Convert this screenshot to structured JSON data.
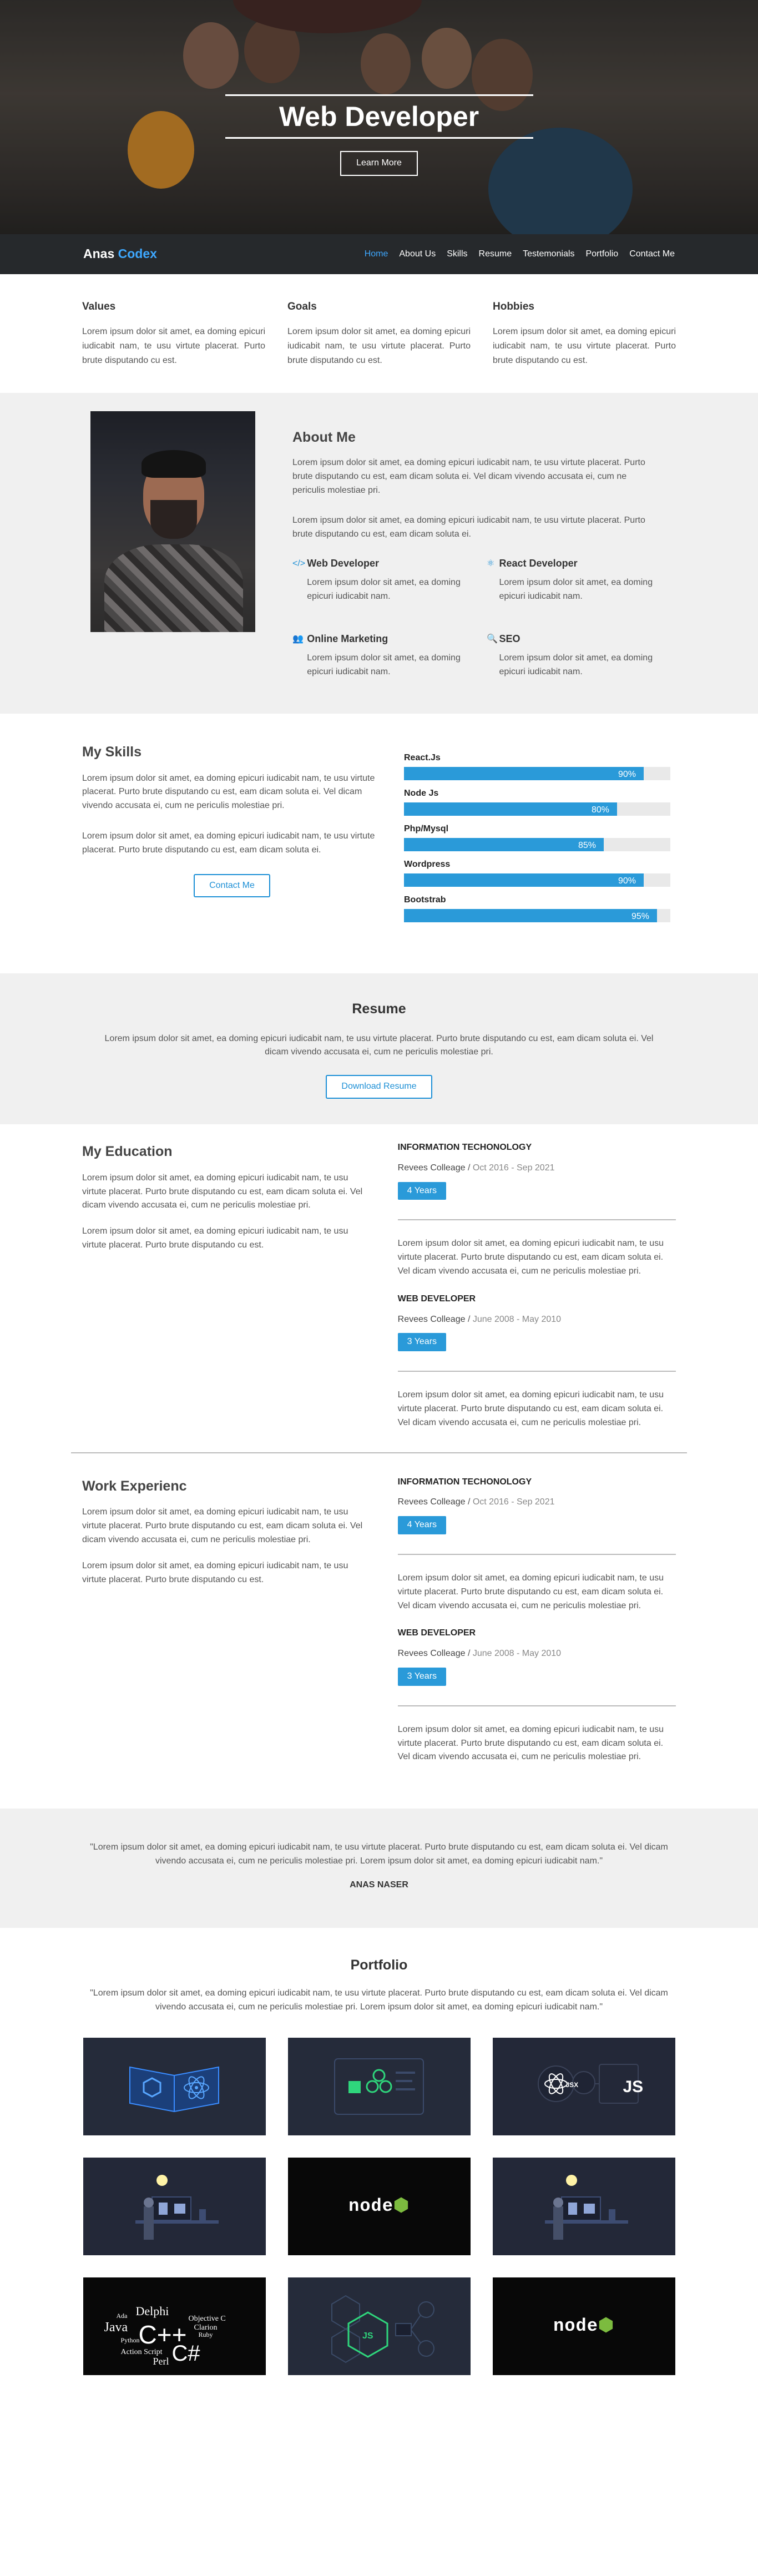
{
  "hero": {
    "title": "Web Developer",
    "button": "Learn More"
  },
  "nav": {
    "brand_first": "Anas",
    "brand_second": "Codex",
    "items": [
      "Home",
      "About Us",
      "Skills",
      "Resume",
      "Testemonials",
      "Portfolio",
      "Contact Me"
    ],
    "accent": "#3ea8ff"
  },
  "values": [
    {
      "title": "Values",
      "text": "Lorem ipsum dolor sit amet, ea doming epicuri iudicabit nam, te usu virtute placerat. Purto brute disputando cu est."
    },
    {
      "title": "Goals",
      "text": "Lorem ipsum dolor sit amet, ea doming epicuri iudicabit nam, te usu virtute placerat. Purto brute disputando cu est."
    },
    {
      "title": "Hobbies",
      "text": "Lorem ipsum dolor sit amet, ea doming epicuri iudicabit nam, te usu virtute placerat. Purto brute disputando cu est."
    }
  ],
  "about": {
    "title": "About Me",
    "p1": "Lorem ipsum dolor sit amet, ea doming epicuri iudicabit nam, te usu virtute placerat. Purto brute disputando cu est, eam dicam soluta ei. Vel dicam vivendo accusata ei, cum ne periculis molestiae pri.",
    "p2": "Lorem ipsum dolor sit amet, ea doming epicuri iudicabit nam, te usu virtute placerat. Purto brute disputando cu est, eam dicam soluta ei.",
    "services": [
      {
        "icon": "code-icon",
        "title": "Web Developer",
        "text": "Lorem ipsum dolor sit amet, ea doming epicuri iudicabit nam."
      },
      {
        "icon": "react-icon",
        "title": "React Developer",
        "text": "Lorem ipsum dolor sit amet, ea doming epicuri iudicabit nam."
      },
      {
        "icon": "users-icon",
        "title": "Online Marketing",
        "text": "Lorem ipsum dolor sit amet, ea doming epicuri iudicabit nam."
      },
      {
        "icon": "search-icon",
        "title": "SEO",
        "text": "Lorem ipsum dolor sit amet, ea doming epicuri iudicabit nam."
      }
    ]
  },
  "skills": {
    "title": "My Skills",
    "p1": "Lorem ipsum dolor sit amet, ea doming epicuri iudicabit nam, te usu virtute placerat. Purto brute disputando cu est, eam dicam soluta ei. Vel dicam vivendo accusata ei, cum ne periculis molestiae pri.",
    "p2": "Lorem ipsum dolor sit amet, ea doming epicuri iudicabit nam, te usu virtute placerat. Purto brute disputando cu est, eam dicam soluta ei.",
    "button": "Contact Me",
    "items": [
      {
        "name": "React.Js",
        "percent": 90,
        "label": "90%"
      },
      {
        "name": "Node Js",
        "percent": 80,
        "label": "80%"
      },
      {
        "name": "Php/Mysql",
        "percent": 75,
        "label": "85%"
      },
      {
        "name": "Wordpress",
        "percent": 90,
        "label": "90%"
      },
      {
        "name": "Bootstrab",
        "percent": 95,
        "label": "95%"
      }
    ]
  },
  "resume": {
    "title": "Resume",
    "text": "Lorem ipsum dolor sit amet, ea doming epicuri iudicabit nam, te usu virtute placerat. Purto brute disputando cu est, eam dicam soluta ei. Vel dicam vivendo accusata ei, cum ne periculis molestiae pri.",
    "button": "Download Resume"
  },
  "education": {
    "title": "My Education",
    "p1": "Lorem ipsum dolor sit amet, ea doming epicuri iudicabit nam, te usu virtute placerat. Purto brute disputando cu est, eam dicam soluta ei. Vel dicam vivendo accusata ei, cum ne periculis molestiae pri.",
    "p2": "Lorem ipsum dolor sit amet, ea doming epicuri iudicabit nam, te usu virtute placerat. Purto brute disputando cu est.",
    "entries": [
      {
        "title": "Information Techonology",
        "school": "Revees Colleage",
        "dates": "Oct 2016 - Sep 2021",
        "badge": "4 Years",
        "text": "Lorem ipsum dolor sit amet, ea doming epicuri iudicabit nam, te usu virtute placerat. Purto brute disputando cu est, eam dicam soluta ei. Vel dicam vivendo accusata ei, cum ne periculis molestiae pri."
      },
      {
        "title": "Web Developer",
        "school": "Revees Colleage",
        "dates": "June 2008 - May 2010",
        "badge": "3 Years",
        "text": "Lorem ipsum dolor sit amet, ea doming epicuri iudicabit nam, te usu virtute placerat. Purto brute disputando cu est, eam dicam soluta ei. Vel dicam vivendo accusata ei, cum ne periculis molestiae pri."
      }
    ]
  },
  "work": {
    "title": "Work Experienc",
    "p1": "Lorem ipsum dolor sit amet, ea doming epicuri iudicabit nam, te usu virtute placerat. Purto brute disputando cu est, eam dicam soluta ei. Vel dicam vivendo accusata ei, cum ne periculis molestiae pri.",
    "p2": "Lorem ipsum dolor sit amet, ea doming epicuri iudicabit nam, te usu virtute placerat. Purto brute disputando cu est.",
    "entries": [
      {
        "title": "Information Techonology",
        "school": "Revees Colleage",
        "dates": "Oct 2016 - Sep 2021",
        "badge": "4 Years",
        "text": "Lorem ipsum dolor sit amet, ea doming epicuri iudicabit nam, te usu virtute placerat. Purto brute disputando cu est, eam dicam soluta ei. Vel dicam vivendo accusata ei, cum ne periculis molestiae pri."
      },
      {
        "title": "Web Developer",
        "school": "Revees Colleage",
        "dates": "June 2008 - May 2010",
        "badge": "3 Years",
        "text": "Lorem ipsum dolor sit amet, ea doming epicuri iudicabit nam, te usu virtute placerat. Purto brute disputando cu est, eam dicam soluta ei. Vel dicam vivendo accusata ei, cum ne periculis molestiae pri."
      }
    ]
  },
  "quote": {
    "text": "\"Lorem ipsum dolor sit amet, ea doming epicuri iudicabit nam, te usu virtute placerat. Purto brute disputando cu est, eam dicam soluta ei. Vel dicam vivendo accusata ei, cum ne periculis molestiae pri. Lorem ipsum dolor sit amet, ea doming epicuri iudicabit nam.\"",
    "author": "ANAS NASER"
  },
  "portfolio": {
    "title": "Portfolio",
    "text": "\"Lorem ipsum dolor sit amet, ea doming epicuri iudicabit nam, te usu virtute placerat. Purto brute disputando cu est, eam dicam soluta ei. Vel dicam vivendo accusata ei, cum ne periculis molestiae pri. Lorem ipsum dolor sit amet, ea doming epicuri iudicabit nam.\"",
    "js_label": "JS",
    "jsx_label": "JSX",
    "node_label": "node",
    "cloud": [
      "Java",
      "Delphi",
      "C++",
      "Objective C",
      "C#",
      "Python",
      "Action Script",
      "Ruby",
      "Perl",
      "Clarion",
      "Ada"
    ]
  }
}
